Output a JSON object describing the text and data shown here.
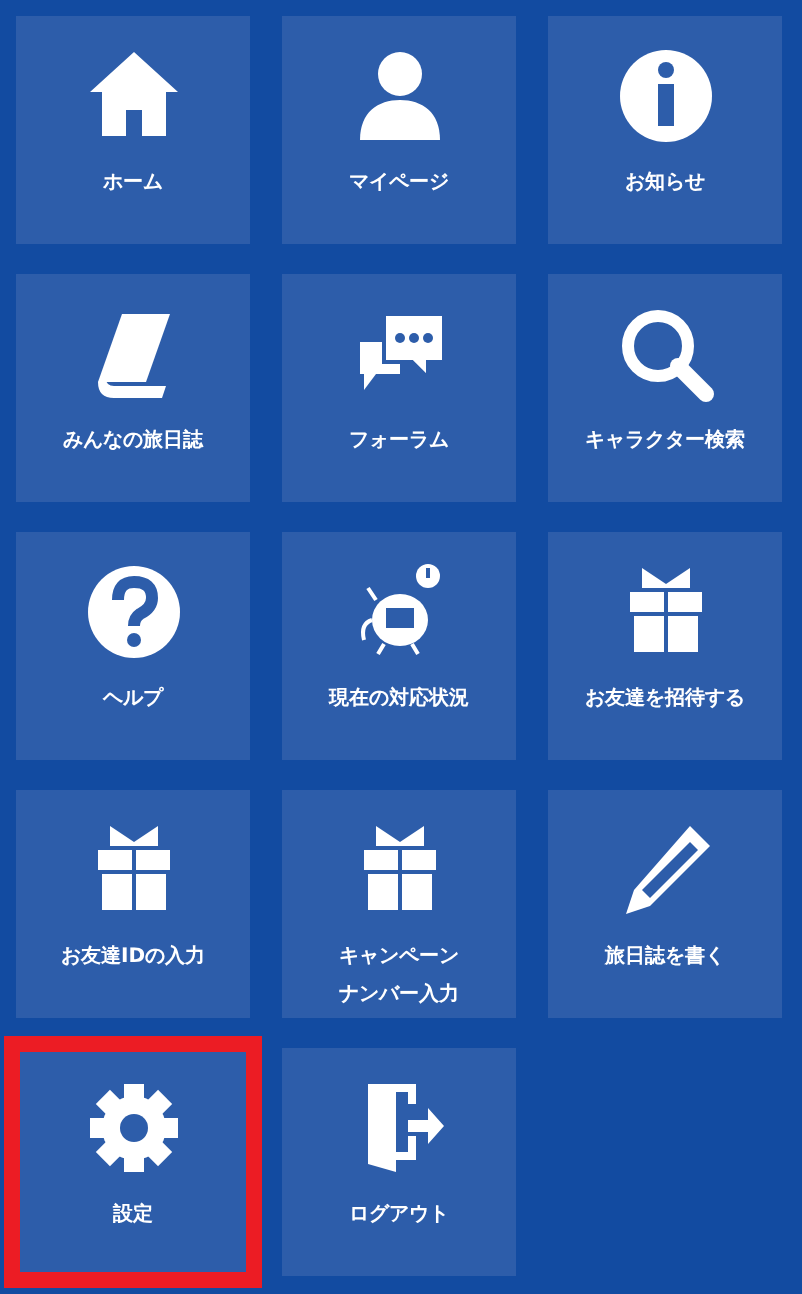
{
  "menu": [
    {
      "lines": [
        "ホーム"
      ],
      "kind": "home",
      "highlighted": false
    },
    {
      "lines": [
        "マイページ"
      ],
      "kind": "person",
      "highlighted": false
    },
    {
      "lines": [
        "お知らせ"
      ],
      "kind": "info",
      "highlighted": false
    },
    {
      "lines": [
        "みんなの旅日誌"
      ],
      "kind": "book",
      "highlighted": false
    },
    {
      "lines": [
        "フォーラム"
      ],
      "kind": "chat",
      "highlighted": false
    },
    {
      "lines": [
        "キャラクター検索"
      ],
      "kind": "search",
      "highlighted": false
    },
    {
      "lines": [
        "ヘルプ"
      ],
      "kind": "help",
      "highlighted": false
    },
    {
      "lines": [
        "現在の対応状況"
      ],
      "kind": "robot",
      "highlighted": false
    },
    {
      "lines": [
        "お友達を招待する"
      ],
      "kind": "gift",
      "highlighted": false
    },
    {
      "lines": [
        "お友達IDの入力"
      ],
      "kind": "gift",
      "highlighted": false
    },
    {
      "lines": [
        "キャンペーン",
        "ナンバー入力"
      ],
      "kind": "gift",
      "highlighted": false
    },
    {
      "lines": [
        "旅日誌を書く"
      ],
      "kind": "pencil",
      "highlighted": false
    },
    {
      "lines": [
        "設定"
      ],
      "kind": "gear",
      "highlighted": true
    },
    {
      "lines": [
        "ログアウト"
      ],
      "kind": "door",
      "highlighted": false
    }
  ]
}
